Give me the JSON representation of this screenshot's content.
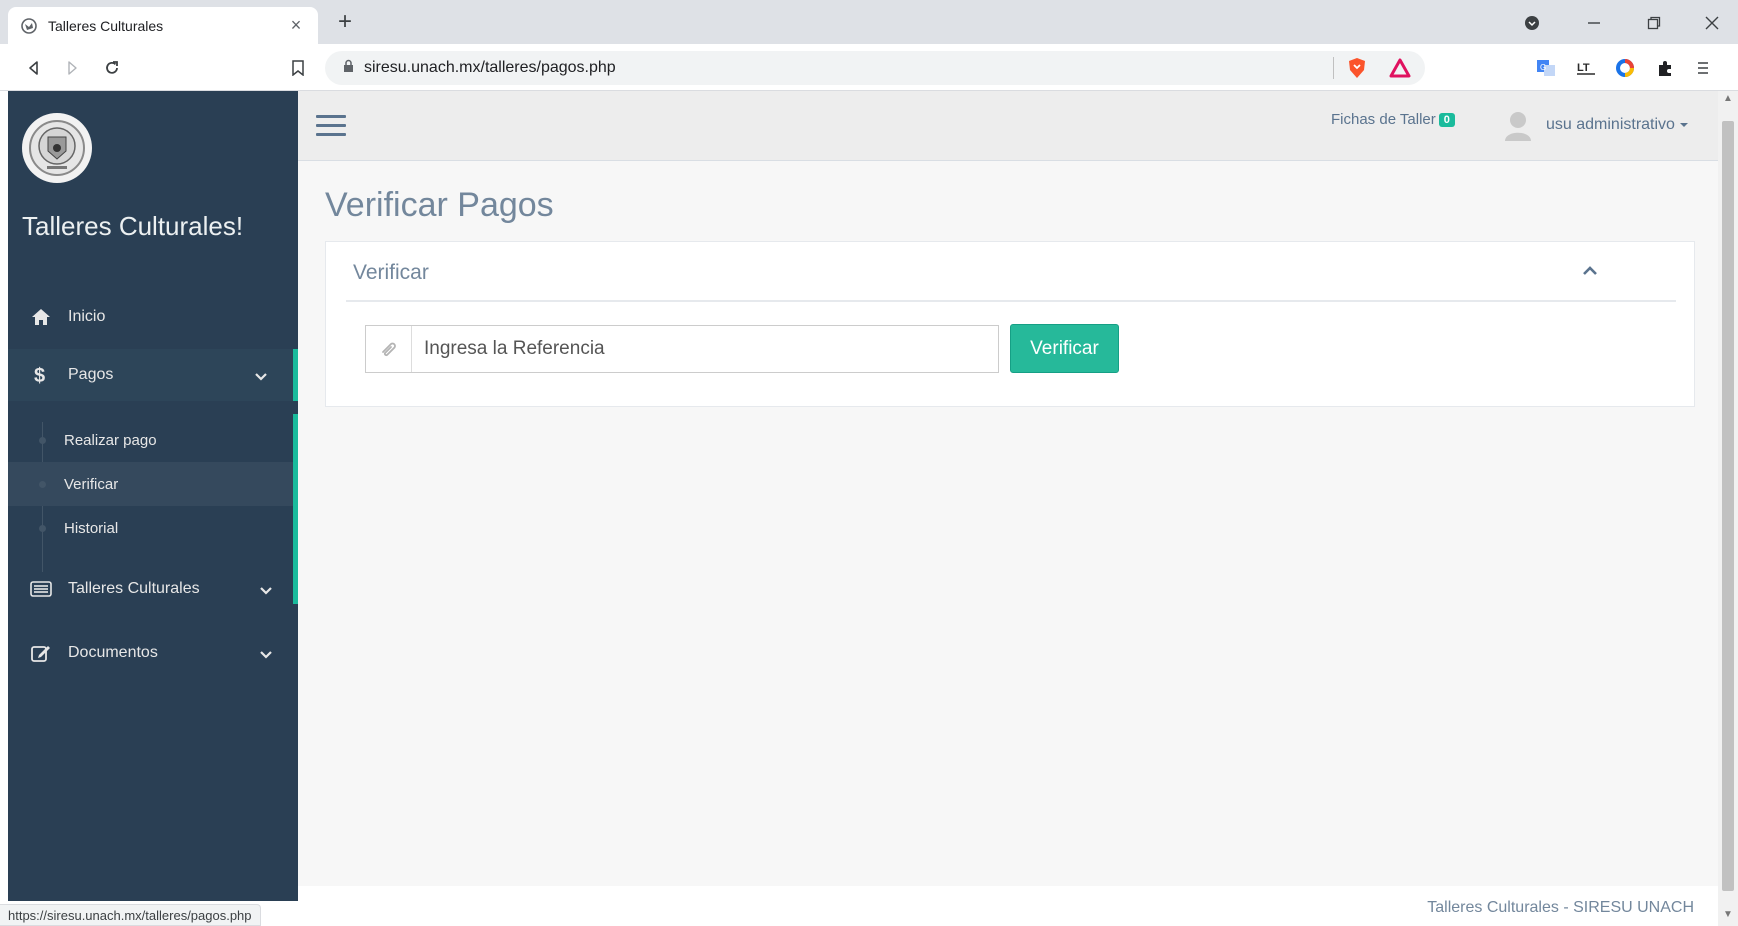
{
  "browser": {
    "tab_title": "Talleres Culturales",
    "tab_close": "×",
    "new_tab": "+",
    "url": "siresu.unach.mx/talleres/pagos.php",
    "status_url": "https://siresu.unach.mx/talleres/pagos.php"
  },
  "sidebar": {
    "title": "Talleres Culturales!",
    "items": [
      {
        "label": "Inicio",
        "icon": "home-icon"
      },
      {
        "label": "Pagos",
        "icon": "dollar-icon"
      },
      {
        "label": "Talleres Culturales",
        "icon": "list-icon"
      },
      {
        "label": "Documentos",
        "icon": "edit-icon"
      }
    ],
    "pagos_submenu": [
      {
        "label": "Realizar pago"
      },
      {
        "label": "Verificar"
      },
      {
        "label": "Historial"
      }
    ]
  },
  "topnav": {
    "fichas_label": "Fichas de Taller",
    "fichas_count": "0",
    "user_name": "usu administrativo"
  },
  "main": {
    "page_title": "Verificar Pagos",
    "panel_title": "Verificar",
    "reference_placeholder": "Ingresa la Referencia",
    "reference_value": "",
    "verify_button": "Verificar"
  },
  "footer": {
    "text": "Talleres Culturales - SIRESU UNACH"
  },
  "colors": {
    "sidebar_bg": "#2a3f54",
    "accent": "#1abb9c",
    "button_green": "#26b99a",
    "text_muted": "#73879c"
  }
}
